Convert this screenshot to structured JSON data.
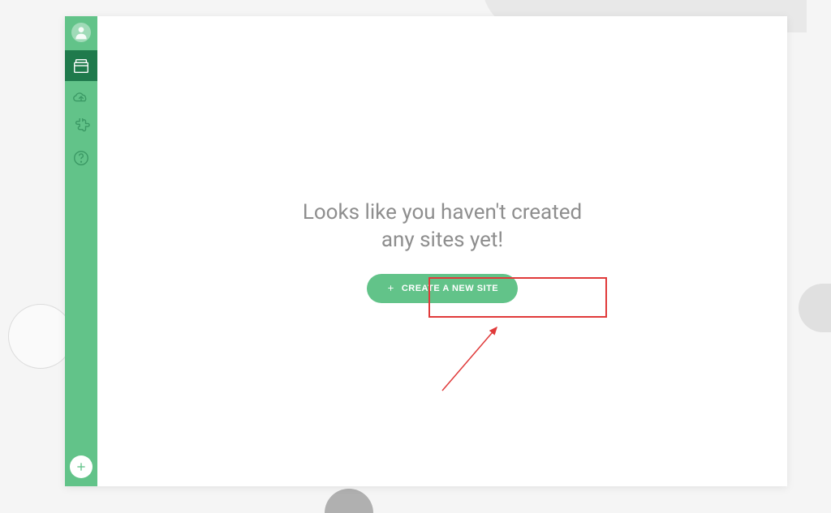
{
  "sidebar": {
    "items": [
      {
        "name": "avatar"
      },
      {
        "name": "sites",
        "active": true
      },
      {
        "name": "cloud"
      },
      {
        "name": "addons"
      },
      {
        "name": "help"
      }
    ],
    "add_label": "Add"
  },
  "empty_state": {
    "title": "Looks like you haven't created any sites yet!",
    "cta_label": "CREATE A NEW SITE"
  },
  "annotation": {
    "type": "highlight-and-arrow"
  },
  "colors": {
    "primary": "#62c389",
    "primary_dark": "#1f7a4c",
    "annotation": "#e03a3a"
  }
}
